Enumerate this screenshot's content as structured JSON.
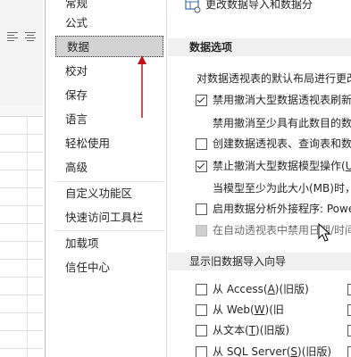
{
  "nav": {
    "items": [
      {
        "label": "常规",
        "name": "nav-item-general"
      },
      {
        "label": "公式",
        "name": "nav-item-formulas"
      },
      {
        "label": "数据",
        "name": "nav-item-data",
        "selected": true
      },
      {
        "label": "校对",
        "name": "nav-item-proofing"
      },
      {
        "label": "保存",
        "name": "nav-item-save"
      },
      {
        "label": "语言",
        "name": "nav-item-language"
      },
      {
        "label": "轻松使用",
        "name": "nav-item-ease-of-access"
      },
      {
        "label": "高级",
        "name": "nav-item-advanced"
      },
      {
        "label": "自定义功能区",
        "name": "nav-item-customize-ribbon"
      },
      {
        "label": "快速访问工具栏",
        "name": "nav-item-quick-access-toolbar"
      },
      {
        "label": "加载项",
        "name": "nav-item-add-ins"
      },
      {
        "label": "信任中心",
        "name": "nav-item-trust-center"
      }
    ]
  },
  "panel": {
    "edit_default_layout": "更改数据导入和数据分",
    "section_data_options": "数据选项",
    "pivot_default_text": "对数据透视表的默认布局进行更改",
    "opt_disable_undo_large_pivot": "禁用撤消大型数据透视表刷新",
    "opt_disable_undo_min_rows": "禁用撤消至少具有此数目的数",
    "opt_prefer_excel_data_model": "创建数据透视表、查询表和数",
    "opt_disable_undo_large_model_pre": "禁止撤消大型数据模型操作(",
    "opt_disable_undo_large_model_key": "U",
    "opt_model_min_size": "当模型至少为此大小(MB)时，",
    "opt_enable_analysis_addins": "启用数据分析外接程序: Powe",
    "opt_disable_date_grouping": "在自动透视表中禁用日期/时间",
    "section_legacy_import": "显示旧数据导入向导",
    "legacy": [
      {
        "pre": "从 Access(",
        "key": "A",
        "post": ")(旧版)"
      },
      {
        "pre": "从 Web(",
        "key": "W",
        "post": ")(旧"
      },
      {
        "pre": "从文本(",
        "key": "T",
        "post": ")(旧版)"
      },
      {
        "pre": "从 SQL Server(",
        "key": "S",
        "post": ")(旧版)"
      }
    ]
  },
  "colors": {
    "accent_red": "#c0141a",
    "selected_nav_bg": "#d3d3d3",
    "section_bg": "#f0f0f0"
  }
}
